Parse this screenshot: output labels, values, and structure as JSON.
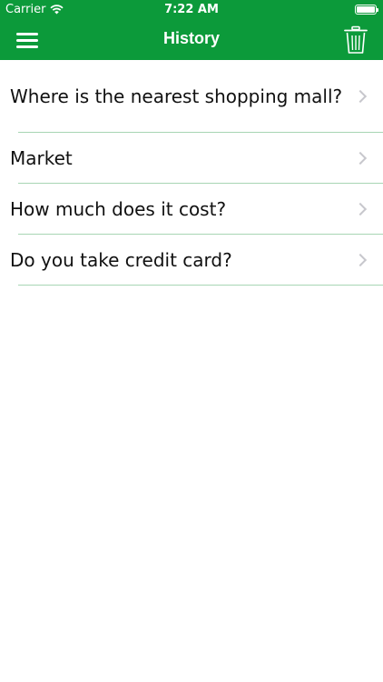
{
  "status_bar": {
    "carrier": "Carrier",
    "time": "7:22 AM",
    "battery_level": 1.0
  },
  "navbar": {
    "title": "History",
    "menu_icon": "hamburger-menu-icon",
    "trash_icon": "trash-icon"
  },
  "history": {
    "items": [
      {
        "text": "Where is the nearest shopping mall?"
      },
      {
        "text": "Market"
      },
      {
        "text": "How much does it cost?"
      },
      {
        "text": "Do you take credit card?"
      }
    ]
  },
  "colors": {
    "header": "#0c9a3a",
    "separator": "#a8d5b4",
    "chevron": "#c7c7cc"
  }
}
